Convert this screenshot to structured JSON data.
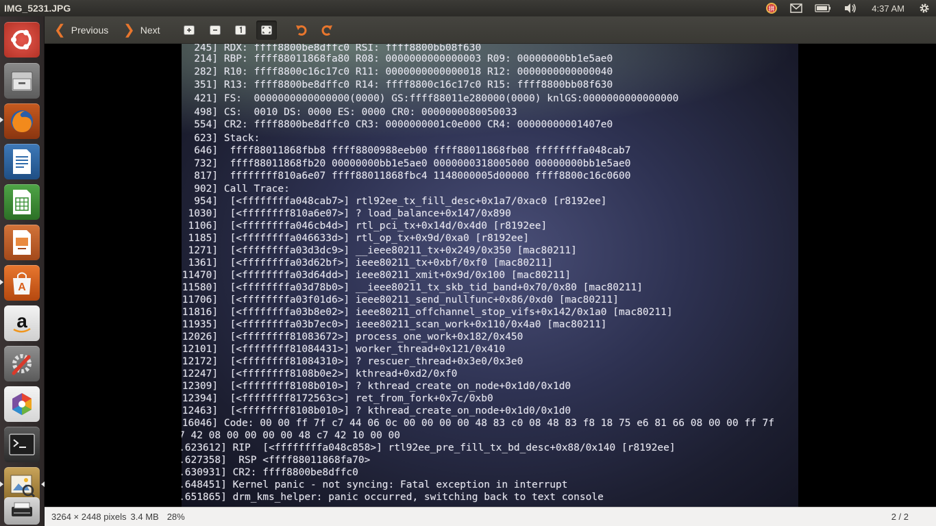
{
  "window": {
    "title": "IMG_5231.JPG"
  },
  "panel": {
    "clock": "4:37 AM"
  },
  "launcher": [
    {
      "name": "launcher-ubuntu-dash"
    },
    {
      "name": "launcher-files"
    },
    {
      "name": "launcher-firefox"
    },
    {
      "name": "launcher-libreoffice-writer"
    },
    {
      "name": "launcher-libreoffice-calc"
    },
    {
      "name": "launcher-libreoffice-impress"
    },
    {
      "name": "launcher-software-center"
    },
    {
      "name": "launcher-amazon"
    },
    {
      "name": "launcher-system-settings"
    },
    {
      "name": "launcher-unity-tweak"
    },
    {
      "name": "launcher-terminal"
    },
    {
      "name": "launcher-image-viewer"
    },
    {
      "name": "launcher-scanner"
    }
  ],
  "toolbar": {
    "previous_label": "Previous",
    "next_label": "Next"
  },
  "screen_lines": [
    "[  245] RDX: ffff8800be8dffc0 RSI: ffff8800bb08f630",
    "[  214] RBP: ffff88011868fa80 R08: 0000000000000003 R09: 00000000bb1e5ae0",
    "[  282] R10: ffff8800c16c17c0 R11: 0000000000000018 R12: 0000000000000040",
    "[  351] R13: ffff8800be8dffc0 R14: ffff8800c16c17c0 R15: ffff8800bb08f630",
    "[  421] FS:  0000000000000000(0000) GS:ffff88011e280000(0000) knlGS:0000000000000000",
    "[  498] CS:  0010 DS: 0000 ES: 0000 CR0: 0000000080050033",
    "[  554] CR2: ffff8800be8dffc0 CR3: 0000000001c0e000 CR4: 00000000001407e0",
    "[  623] Stack:",
    "[  646]  ffff88011868fbb8 ffff8800988eeb00 ffff88011868fb08 ffffffffa048cab7",
    "[  732]  ffff88011868fb20 00000000bb1e5ae0 0000000318005000 00000000bb1e5ae0",
    "[  817]  ffffffff810a6e07 ffff88011868fbc4 1148000005d00000 ffff8800c16c0600",
    "[  902] Call Trace:",
    "[  954]  [<ffffffffa048cab7>] rtl92ee_tx_fill_desc+0x1a7/0xac0 [r8192ee]",
    "[ 1030]  [<ffffffff810a6e07>] ? load_balance+0x147/0x890",
    "[ 1106]  [<ffffffffa046cb4d>] rtl_pci_tx+0x14d/0x4d0 [r8192ee]",
    "[ 1185]  [<ffffffffa046633d>] rtl_op_tx+0x9d/0xa0 [r8192ee]",
    "[ 1271]  [<ffffffffa03d3dc9>] __ieee80211_tx+0x249/0x350 [mac80211]",
    "[ 1361]  [<ffffffffa03d62bf>] ieee80211_tx+0xbf/0xf0 [mac80211]",
    "[11470]  [<ffffffffa03d64dd>] ieee80211_xmit+0x9d/0x100 [mac80211]",
    "[11580]  [<ffffffffa03d78b0>] __ieee80211_tx_skb_tid_band+0x70/0x80 [mac80211]",
    "[11706]  [<ffffffffa03f01d6>] ieee80211_send_nullfunc+0x86/0xd0 [mac80211]",
    "[11816]  [<ffffffffa03b8e02>] ieee80211_offchannel_stop_vifs+0x142/0x1a0 [mac80211]",
    "[11935]  [<ffffffffa03b7ec0>] ieee80211_scan_work+0x110/0x4a0 [mac80211]",
    "[12026]  [<ffffffff81083672>] process_one_work+0x182/0x450",
    "[12101]  [<ffffffff81084431>] worker_thread+0x121/0x410",
    "[12172]  [<ffffffff81084310>] ? rescuer_thread+0x3e0/0x3e0",
    "[12247]  [<ffffffff8108b0e2>] kthread+0xd2/0xf0",
    "[12309]  [<ffffffff8108b010>] ? kthread_create_on_node+0x1d0/0x1d0",
    "[12394]  [<ffffffff8172563c>] ret_from_fork+0x7c/0xb0",
    "[12463]  [<ffffffff8108b010>] ? kthread_create_on_node+0x1d0/0x1d0",
    "[16046] Code: 00 00 ff 7f c7 44 06 0c 00 00 00 00 48 83 c0 08 48 83 f8 18 75 e6 81 66 08 00 00 ff 7f",
    "7 42 08 00 00 00 00 48 c7 42 10 00 00",
    ".623612] RIP  [<ffffffffa048c858>] rtl92ee_pre_fill_tx_bd_desc+0x88/0x140 [r8192ee]",
    ".627358]  RSP <ffff88011868fa70>",
    ".630931] CR2: ffff8800be8dffc0",
    ".648451] Kernel panic - not syncing: Fatal exception in interrupt",
    ".651865] drm_kms_helper: panic occurred, switching back to text console"
  ],
  "status": {
    "dimensions": "3264 × 2448 pixels",
    "filesize": "3.4 MB",
    "zoom": "28%",
    "position": "2 / 2"
  },
  "colors": {
    "accent_orange": "#e8762d",
    "panel_bg": "#3c3b37",
    "launcher_bg": "#352f2f"
  }
}
